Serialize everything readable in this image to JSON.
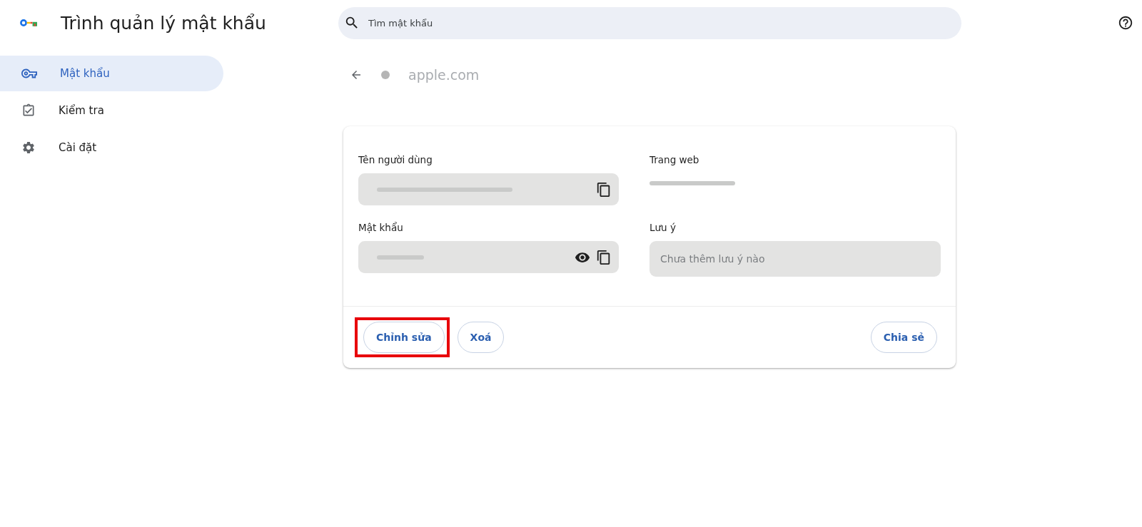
{
  "app": {
    "title": "Trình quản lý mật khẩu"
  },
  "search": {
    "placeholder": "Tìm mật khẩu"
  },
  "sidebar": {
    "items": [
      {
        "label": "Mật khẩu",
        "selected": true
      },
      {
        "label": "Kiểm tra",
        "selected": false
      },
      {
        "label": "Cài đặt",
        "selected": false
      }
    ]
  },
  "detail": {
    "site": "apple.com",
    "username": {
      "label": "Tên người dùng"
    },
    "website": {
      "label": "Trang web"
    },
    "password": {
      "label": "Mật khẩu"
    },
    "note": {
      "label": "Lưu ý",
      "placeholder": "Chưa thêm lưu ý nào"
    }
  },
  "actions": [
    {
      "label": "Chỉnh sửa",
      "highlighted": true
    },
    {
      "label": "Xoá",
      "highlighted": false
    },
    {
      "label": "Chia sẻ",
      "highlighted": false
    }
  ]
}
